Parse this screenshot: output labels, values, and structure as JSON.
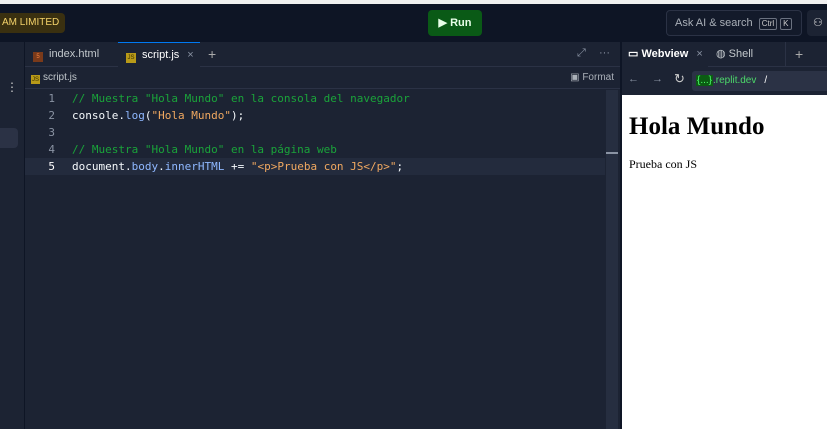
{
  "topbar": {
    "team": "AM LIMITED",
    "run": "Run",
    "search": "Ask AI & search",
    "kbd1": "Ctrl",
    "kbd2": "K"
  },
  "editor": {
    "tabs": [
      {
        "label": "index.html",
        "icon": "html-file-icon"
      },
      {
        "label": "script.js",
        "icon": "js-file-icon",
        "active": true
      }
    ],
    "add": "+",
    "breadcrumb": "script.js",
    "format": "Format",
    "more": "···",
    "lines": [
      {
        "n": "1",
        "parts": [
          [
            "cm",
            "// Muestra \"Hola Mundo\" en la consola del navegador"
          ]
        ]
      },
      {
        "n": "2",
        "parts": [
          [
            "",
            "console."
          ],
          [
            "pr",
            "log"
          ],
          [
            "",
            "("
          ],
          [
            "st",
            "\"Hola Mundo\""
          ],
          [
            "",
            ");"
          ]
        ]
      },
      {
        "n": "3",
        "parts": []
      },
      {
        "n": "4",
        "parts": [
          [
            "cm",
            "// Muestra \"Hola Mundo\" en la página web"
          ]
        ]
      },
      {
        "n": "5",
        "parts": [
          [
            "",
            "document."
          ],
          [
            "pr",
            "body"
          ],
          [
            "",
            "."
          ],
          [
            "pr",
            "innerHTML"
          ],
          [
            "",
            " += "
          ],
          [
            "st",
            "\"<p>Prueba con JS</p>\""
          ],
          [
            "",
            ";"
          ]
        ]
      }
    ]
  },
  "preview": {
    "tab1": "Webview",
    "tab2": "Shell",
    "add": "+",
    "domain": "{...}",
    "host": ".replit.dev",
    "path": "/",
    "heading": "Hola Mundo",
    "paragraph": "Prueba con JS"
  }
}
